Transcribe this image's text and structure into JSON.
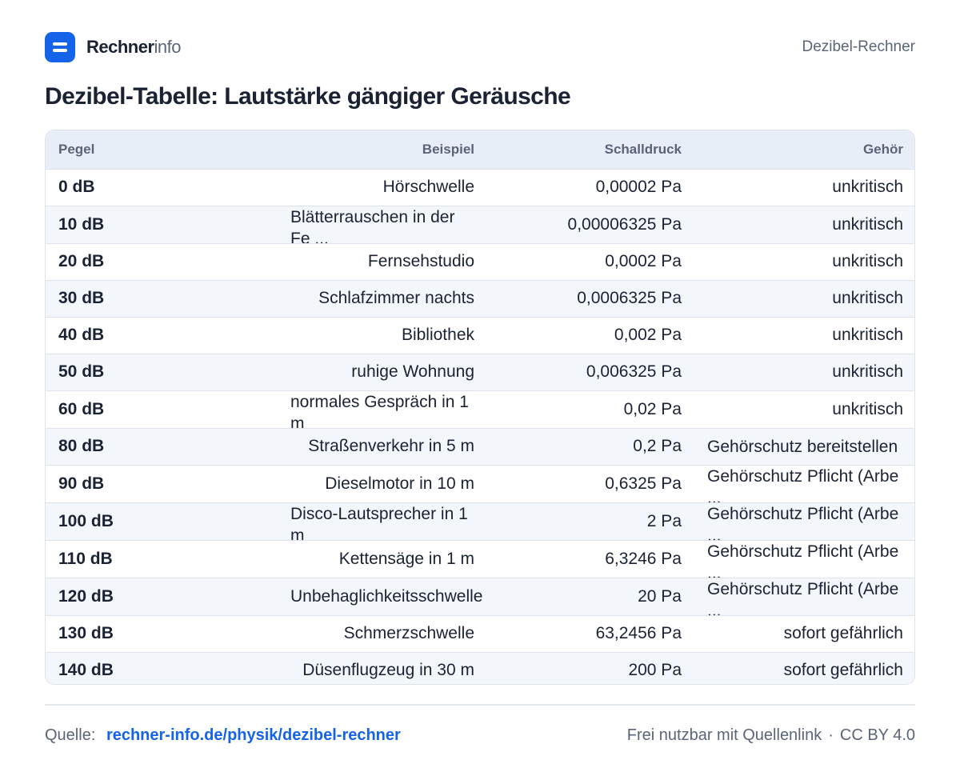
{
  "header": {
    "logo_strong": "Rechner",
    "logo_light": "info",
    "right_label": "Dezibel-Rechner"
  },
  "title": "Dezibel-Tabelle: Lautstärke gängiger Geräusche",
  "table": {
    "headers": [
      "Pegel",
      "Beispiel",
      "Schalldruck",
      "Gehör"
    ],
    "rows": [
      {
        "pegel": "0 dB",
        "beispiel": "Hörschwelle",
        "schalldruck": "0,00002 Pa",
        "gehoer": "unkritisch"
      },
      {
        "pegel": "10 dB",
        "beispiel": "Blätterrauschen in der Fe ...",
        "schalldruck": "0,00006325 Pa",
        "gehoer": "unkritisch"
      },
      {
        "pegel": "20 dB",
        "beispiel": "Fernsehstudio",
        "schalldruck": "0,0002 Pa",
        "gehoer": "unkritisch"
      },
      {
        "pegel": "30 dB",
        "beispiel": "Schlafzimmer nachts",
        "schalldruck": "0,0006325 Pa",
        "gehoer": "unkritisch"
      },
      {
        "pegel": "40 dB",
        "beispiel": "Bibliothek",
        "schalldruck": "0,002 Pa",
        "gehoer": "unkritisch"
      },
      {
        "pegel": "50 dB",
        "beispiel": "ruhige Wohnung",
        "schalldruck": "0,006325 Pa",
        "gehoer": "unkritisch"
      },
      {
        "pegel": "60 dB",
        "beispiel": "normales Gespräch in 1 m",
        "schalldruck": "0,02 Pa",
        "gehoer": "unkritisch"
      },
      {
        "pegel": "80 dB",
        "beispiel": "Straßenverkehr in 5 m",
        "schalldruck": "0,2 Pa",
        "gehoer": "Gehörschutz bereitstellen"
      },
      {
        "pegel": "90 dB",
        "beispiel": "Dieselmotor in 10 m",
        "schalldruck": "0,6325 Pa",
        "gehoer": "Gehörschutz Pflicht (Arbe ..."
      },
      {
        "pegel": "100 dB",
        "beispiel": "Disco-Lautsprecher in 1 m",
        "schalldruck": "2 Pa",
        "gehoer": "Gehörschutz Pflicht (Arbe ..."
      },
      {
        "pegel": "110 dB",
        "beispiel": "Kettensäge in 1 m",
        "schalldruck": "6,3246 Pa",
        "gehoer": "Gehörschutz Pflicht (Arbe ..."
      },
      {
        "pegel": "120 dB",
        "beispiel": "Unbehaglichkeitsschwelle",
        "schalldruck": "20 Pa",
        "gehoer": "Gehörschutz Pflicht (Arbe ..."
      },
      {
        "pegel": "130 dB",
        "beispiel": "Schmerzschwelle",
        "schalldruck": "63,2456 Pa",
        "gehoer": "sofort gefährlich"
      },
      {
        "pegel": "140 dB",
        "beispiel": "Düsenflugzeug in 30 m",
        "schalldruck": "200 Pa",
        "gehoer": "sofort gefährlich"
      }
    ]
  },
  "footer": {
    "source_label": "Quelle:",
    "source_link": "rechner-info.de/physik/dezibel-rechner",
    "license_text": "Frei nutzbar mit Quellenlink",
    "separator": "·",
    "license": "CC BY 4.0"
  },
  "colors": {
    "accent": "#1463e8",
    "text": "#1a2233",
    "muted": "#5a6478",
    "header_bg": "#e8eef7",
    "row_alt": "#f3f6fb",
    "border": "#dde3ec"
  }
}
